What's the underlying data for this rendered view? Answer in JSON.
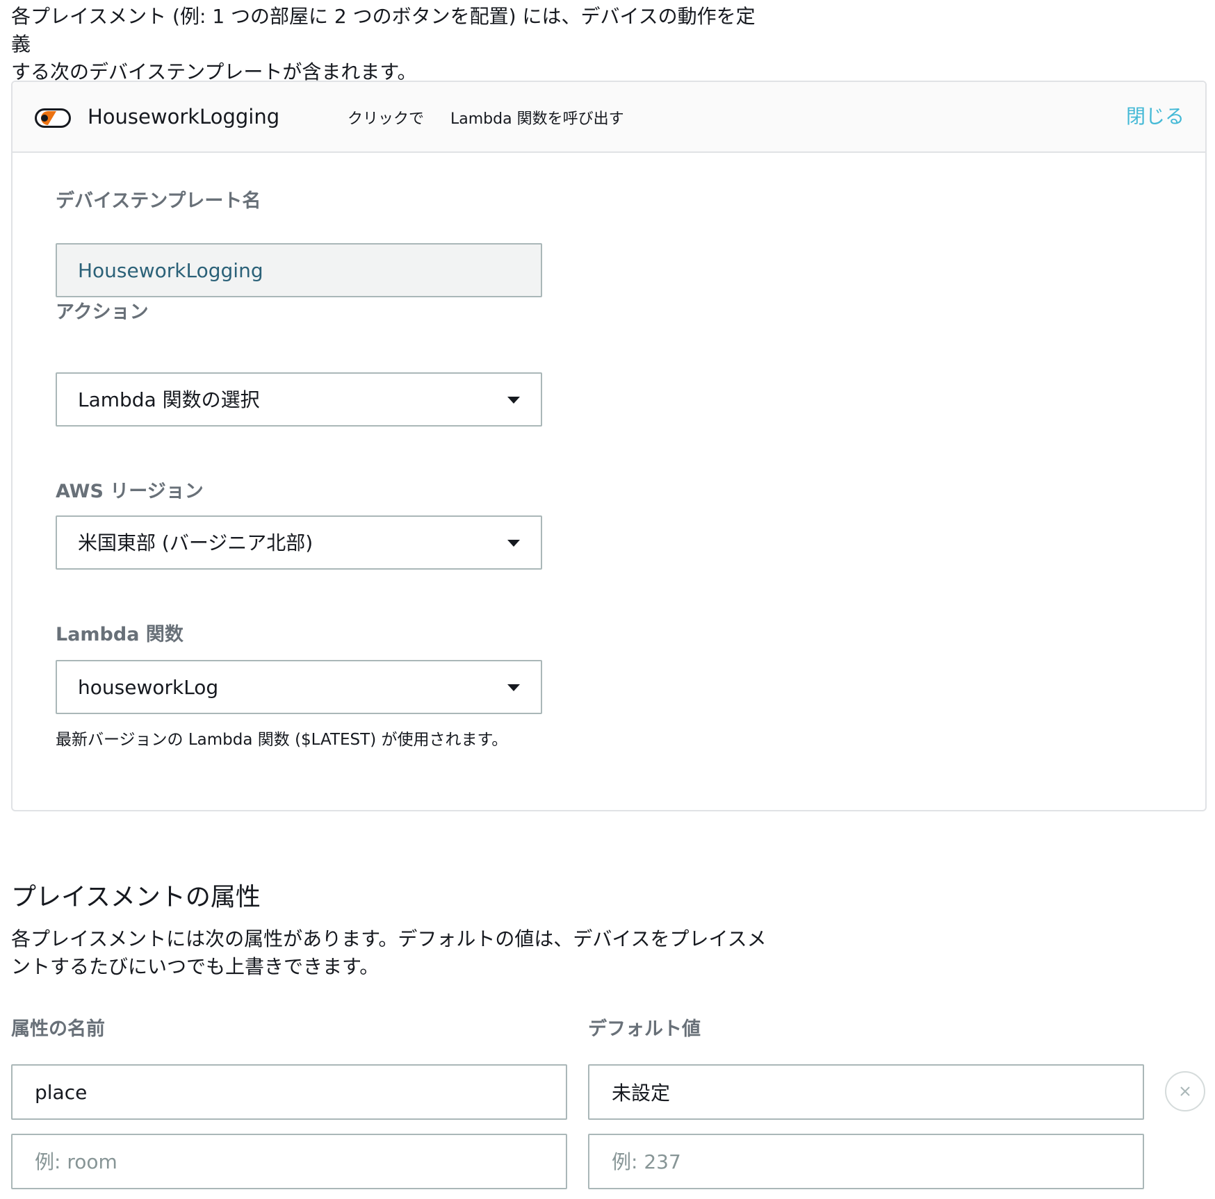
{
  "intro": {
    "line1": "各プレイスメント (例: 1 つの部屋に 2 つのボタンを配置) には、デバイスの動作を定義",
    "line2": "する次のデバイステンプレートが含まれます。"
  },
  "template_card": {
    "title": "HouseworkLogging",
    "trigger": "クリックで",
    "trigger_action": "Lambda 関数を呼び出す",
    "close_label": "閉じる",
    "fields": {
      "template_name": {
        "label": "デバイステンプレート名",
        "value": "HouseworkLogging"
      },
      "action": {
        "label": "アクション",
        "selected": "Lambda 関数の選択"
      },
      "region": {
        "label": "AWS リージョン",
        "selected": "米国東部 (バージニア北部)"
      },
      "lambda_function": {
        "label": "Lambda 関数",
        "selected": "houseworkLog",
        "hint": "最新バージョンの Lambda 関数 ($LATEST) が使用されます。"
      }
    }
  },
  "attributes": {
    "title": "プレイスメントの属性",
    "desc_line1": "各プレイスメントには次の属性があります。デフォルトの値は、デバイスをプレイスメ",
    "desc_line2": "ントするたびにいつでも上書きできます。",
    "name_header": "属性の名前",
    "value_header": "デフォルト値",
    "rows": [
      {
        "name": "place",
        "default_value": "未設定"
      }
    ],
    "new_row": {
      "name_placeholder": "例: room",
      "value_placeholder": "例: 237"
    }
  },
  "colors": {
    "accent_link": "#44b9d6",
    "toggle_orange": "#ec7211",
    "label_gray": "#687078",
    "border": "#aab7b8"
  },
  "icons": {
    "toggle": "toggle-switch-icon",
    "caret": "caret-down-icon",
    "remove": "close-icon"
  }
}
